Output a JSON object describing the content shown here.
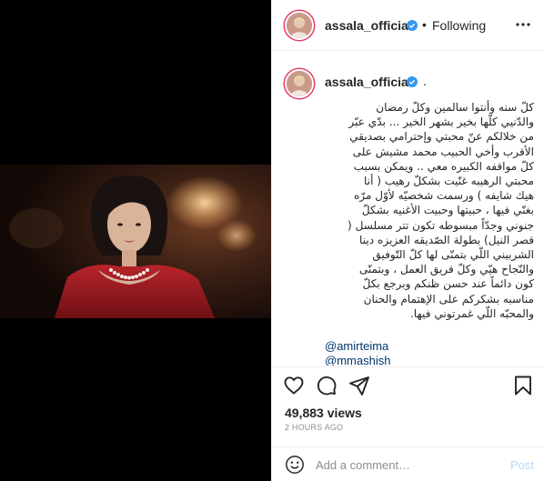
{
  "header": {
    "username": "assala_official",
    "separator": "•",
    "follow_status": "Following"
  },
  "caption": {
    "username": "assala_official",
    "suffix": ".",
    "lines": [
      "كلّ سنه وأنتوا سالمين وكلّ رمضان",
      "والدّنيي كلّها بخير بشهر الخير ... بدّي عبّر",
      "من خلالكم عنّ محبتي وإحترامي بصديقي",
      "الأقرب وأخي الحبيب محمد مشيش على",
      "كلّ مواقفه الكبيره معي .. ويمكن بسبب",
      "محبتي الرهيبه غنّيت بشكلّ رهيب ( أنا",
      "هيك شايفه ) ورسمت شخصيّه لأوّل مرّه",
      "بغنّي فيها ، حبيتها وحبيت الأغنيه بشكلّ",
      "جنوني وجدّاً مبسوطه تكون تتر مسلسل (",
      "قصر النيل) بطولة الصّديقه العزيزه دينا",
      "الشربيني اللّي بتمنّى لها كلّ التّوفيق",
      "والنّجاح هيّي وكلّ فريق العمل ، وبتمنّى",
      "كون دائماً عند حسن ظنكم وبرجع بكلّ",
      "مناسبه بشكركم على الإهتمام والحنان",
      "والمحبّه اللّي غمرتوني فيها."
    ],
    "mentions": [
      "@amirteima",
      "@mmashish"
    ]
  },
  "stats": {
    "views": "49,883 views",
    "time": "2 HOURS AGO"
  },
  "comment_box": {
    "placeholder": "Add a comment…",
    "post_label": "Post"
  },
  "colors": {
    "verified": "#3897f0",
    "mention": "#00376b",
    "post_disabled": "#b3dbff",
    "story_ring": "#e33a68"
  },
  "icons": [
    "more-icon",
    "heart-icon",
    "comment-icon",
    "share-icon",
    "bookmark-icon",
    "emoji-icon",
    "verified-icon"
  ]
}
